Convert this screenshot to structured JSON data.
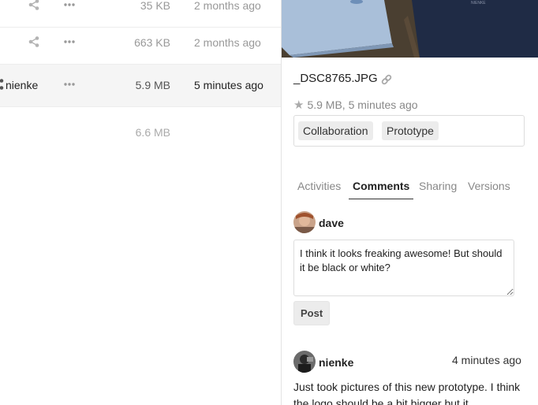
{
  "files": [
    {
      "name": "",
      "size": "35 KB",
      "modified": "2 months ago"
    },
    {
      "name": "",
      "size": "663 KB",
      "modified": "2 months ago"
    },
    {
      "name": "nienke",
      "size": "5.9 MB",
      "modified": "5 minutes ago"
    }
  ],
  "total_size": "6.6 MB",
  "details": {
    "filename": "_DSC8765.JPG",
    "meta": "5.9 MB, 5 minutes ago",
    "tags": [
      "Collaboration",
      "Prototype"
    ],
    "tabs": [
      "Activities",
      "Comments",
      "Sharing",
      "Versions"
    ],
    "active_tab": "Comments",
    "compose": {
      "author": "dave",
      "text": "I think it looks freaking awesome! But should it be black or white?",
      "post_label": "Post"
    },
    "comment": {
      "author": "nienke",
      "time": "4 minutes ago",
      "text": "Just took pictures of this new prototype. I think the logo should be a bit bigger but it"
    }
  },
  "icons": {
    "share": "share-icon",
    "more": "more-icon",
    "link": "link-icon",
    "star": "star-icon"
  },
  "colors": {
    "muted_text": "#999999",
    "highlight_row": "#f5f5f5",
    "tag_bg": "#ececec"
  }
}
